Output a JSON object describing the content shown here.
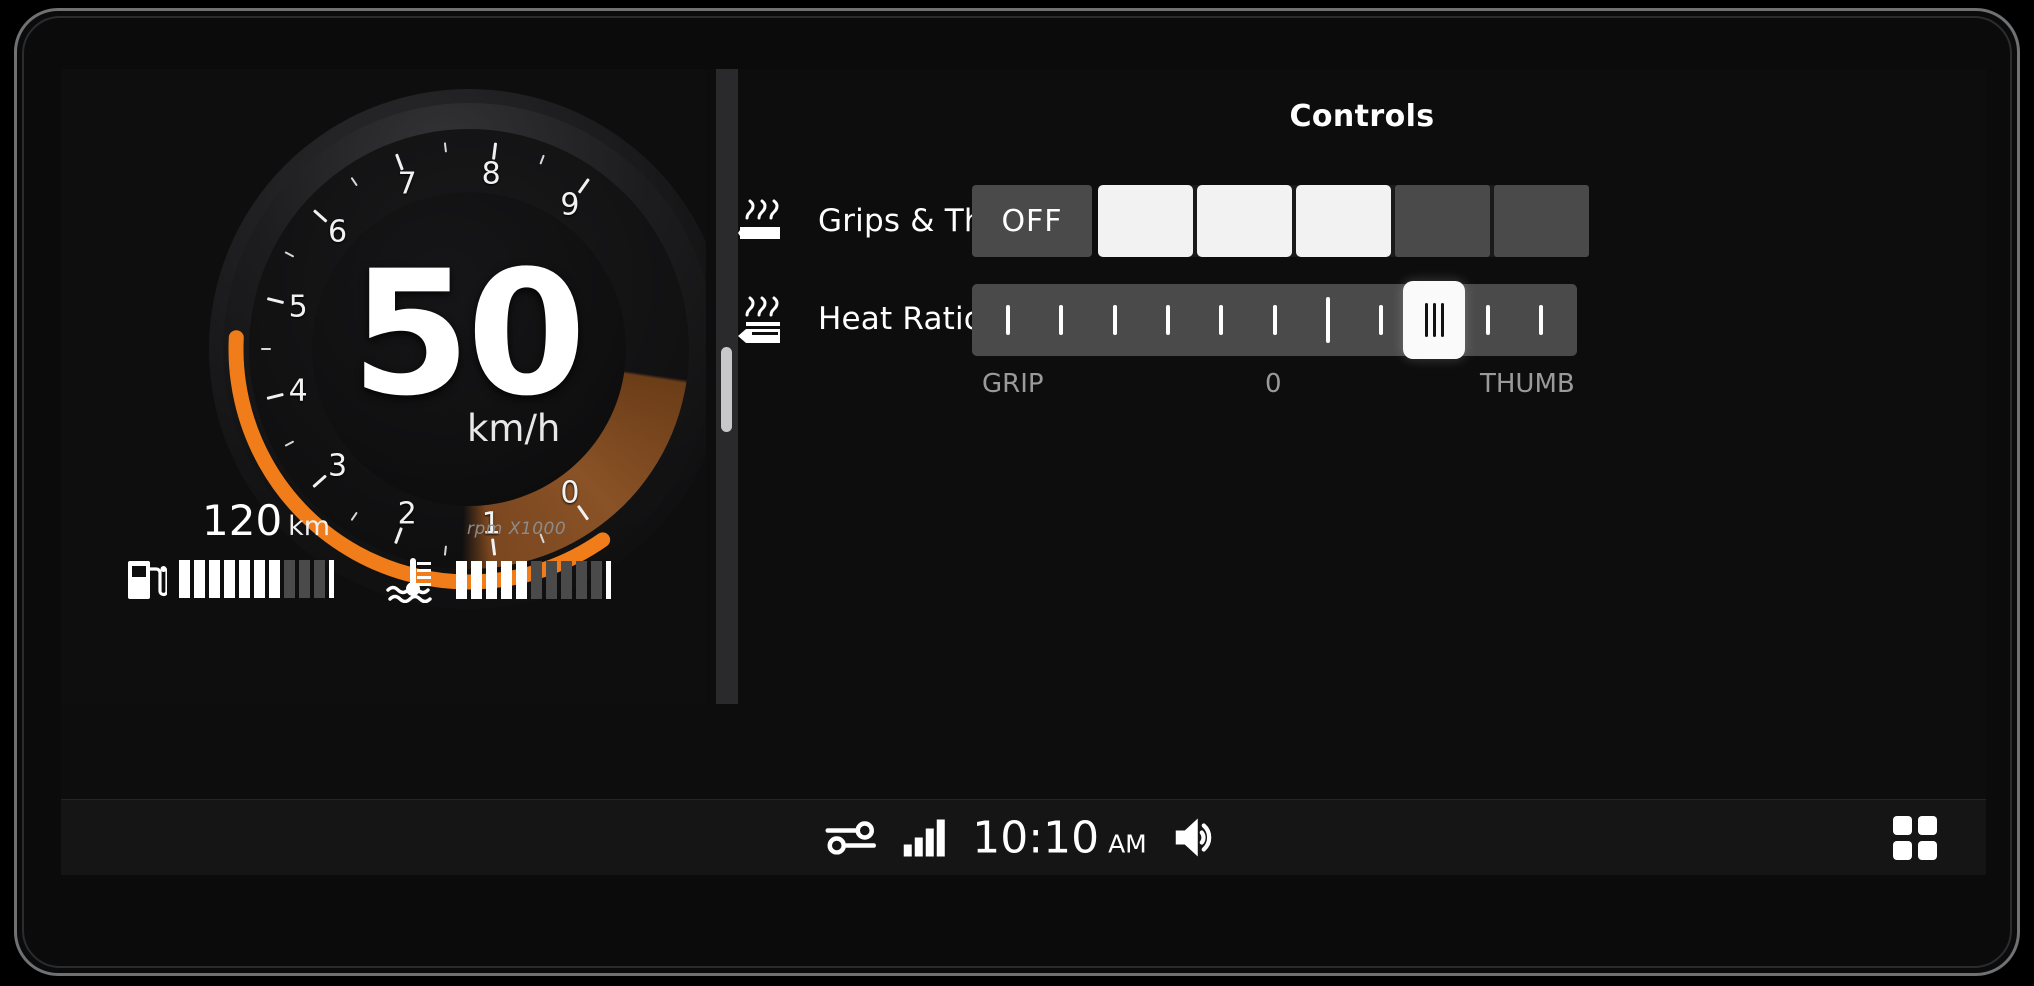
{
  "cluster": {
    "speed_value": "50",
    "speed_unit": "km/h",
    "rpm_label": "rpm X1000",
    "odometer_value": "120",
    "odometer_unit": "km",
    "tach_labels": [
      "0",
      "1",
      "2",
      "3",
      "4",
      "5",
      "6",
      "7",
      "8",
      "9"
    ],
    "tach_max": 9,
    "tach_needle_rpm": 4.6,
    "fuel": {
      "icon": "fuel-pump-icon",
      "total_bars": 10,
      "filled_bars": 7
    },
    "temp": {
      "icon": "coolant-temperature-icon",
      "total_bars": 10,
      "filled_bars": 5
    },
    "accent_color": "#f07d1a",
    "sweep_color": "#8a5226"
  },
  "divider": {
    "name": "vertical-scrollbar",
    "thumb_position_pct": 44
  },
  "controls": {
    "title": "Controls",
    "rows": [
      {
        "icon": "heated-grips-icon",
        "label": "Grips & Thumb",
        "type": "segmented",
        "off_label": "OFF",
        "segments": 5,
        "active_segments": 3
      },
      {
        "icon": "heat-ratio-icon",
        "label": "Heat Ratio",
        "type": "slider",
        "ticks": 11,
        "value_index": 8,
        "center_index": 6,
        "scale_left": "GRIP",
        "scale_center": "0",
        "scale_right": "THUMB"
      }
    ]
  },
  "statusbar": {
    "settings_icon": "sliders-icon",
    "signal_icon": "signal-bars-icon",
    "time": "10:10",
    "ampm": "AM",
    "volume_icon": "speaker-volume-icon",
    "grid_icon": "app-grid-icon"
  }
}
